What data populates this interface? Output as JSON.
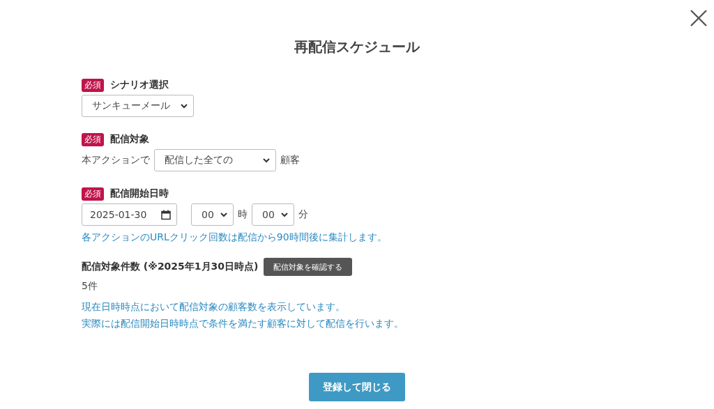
{
  "title": "再配信スケジュール",
  "scenario": {
    "required_badge": "必須",
    "label": "シナリオ選択",
    "value": "サンキューメール"
  },
  "target": {
    "required_badge": "必須",
    "label": "配信対象",
    "prefix": "本アクションで",
    "value": "配信した全ての",
    "suffix": "顧客"
  },
  "start": {
    "required_badge": "必須",
    "label": "配信開始日時",
    "date": "2025-01-30",
    "hour": "00",
    "hour_unit": "時",
    "minute": "00",
    "minute_unit": "分",
    "note": "各アクションのURLクリック回数は配信から90時間後に集計します。"
  },
  "count": {
    "label": "配信対象件数 (※2025年1月30日時点)",
    "button": "配信対象を確認する",
    "value": "5件",
    "notes": [
      "現在日時時点において配信対象の顧客数を表示しています。",
      "実際には配信開始日時時点で条件を満たす顧客に対して配信を行います。"
    ]
  },
  "submit": "登録して閉じる"
}
